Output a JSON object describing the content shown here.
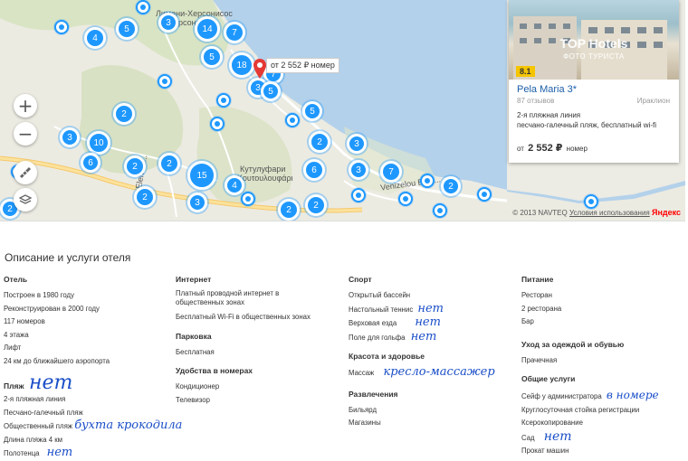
{
  "map": {
    "zoom_in": "+",
    "zoom_out": "−",
    "labels": {
      "town_top": "Лимени-Херсонисос",
      "town_top2": "Херсонисос",
      "town_mid": "Кутулуфари",
      "town_mid2": "Κουτουλουφάρι",
      "street1": "Elefther...",
      "street2": "Venizelou Eleft..."
    },
    "pin_price": "от 2 552 ₽ номер",
    "copyright": "© 2013 NAVTEQ",
    "terms": "Условия использования",
    "brand": "Яндекс",
    "clusters": [
      "14",
      "7",
      "4",
      "5",
      "3",
      "5",
      "18",
      "7",
      "3",
      "5",
      "5",
      "2",
      "3",
      "3",
      "10",
      "6",
      "2",
      "2",
      "2",
      "15",
      "3",
      "4",
      "2",
      "2",
      "6",
      "3",
      "7",
      "2",
      "2",
      "2"
    ]
  },
  "card": {
    "watermark": "TOP Hotels",
    "watermark_sub": "ФОТО ТУРИСТА",
    "rating": "8.1",
    "name": "Pela Maria 3*",
    "reviews": "87 отзывов",
    "city": "Ираклион",
    "feature1": "2-я пляжная линия",
    "feature2": "песчано-галечный пляж, бесплатный wi-fi",
    "price_prefix": "от",
    "price": "2 552 ₽",
    "price_suffix": "номер"
  },
  "description": {
    "title": "Описание и услуги отеля",
    "col1": {
      "hotel_title": "Отель",
      "hotel_items": [
        "Построен в 1980 году",
        "Реконструирован в 2000 году",
        "117 номеров",
        "4 этажа",
        "Лифт",
        "24 км до ближайшего аэропорта"
      ],
      "beach_title": "Пляж",
      "beach_note": "нет",
      "beach_items": [
        "2-я пляжная линия",
        "Песчано-галечный пляж",
        "Общественный пляж",
        "Длина пляжа 4 км",
        "Полотенца"
      ],
      "beach_note2": "бухта крокодила",
      "towels_note": "нет"
    },
    "col2": {
      "internet_title": "Интернет",
      "internet_item1a": "Платный проводной интернет в",
      "internet_item1b": "общественных зонах",
      "internet_item2": "Бесплатный Wi-Fi в общественных зонах",
      "parking_title": "Парковка",
      "parking_item": "Бесплатная",
      "room_title": "Удобства в номерах",
      "room_items": [
        "Кондиционер",
        "Телевизор"
      ]
    },
    "col3": {
      "sport_title": "Спорт",
      "sport_items": [
        "Открытый бассейн",
        "Настольный теннис",
        "Верховая езда",
        "Поле для гольфа"
      ],
      "sport_notes": [
        "нет",
        "нет",
        "нет"
      ],
      "beauty_title": "Красота и здоровье",
      "beauty_item": "Массаж",
      "beauty_note": "кресло-массажер",
      "fun_title": "Развлечения",
      "fun_items": [
        "Бильярд",
        "Магазины"
      ]
    },
    "col4": {
      "food_title": "Питание",
      "food_items": [
        "Ресторан",
        "2 ресторана",
        "Бар"
      ],
      "care_title": "Уход за одеждой и обувью",
      "care_item": "Прачечная",
      "common_title": "Общие услуги",
      "common_items": [
        "Сейф у администратора",
        "Круглосуточная стойка регистрации",
        "Ксерокопирование",
        "Сад",
        "Прокат машин"
      ],
      "safe_note": "в номере",
      "garden_note": "нет"
    }
  }
}
